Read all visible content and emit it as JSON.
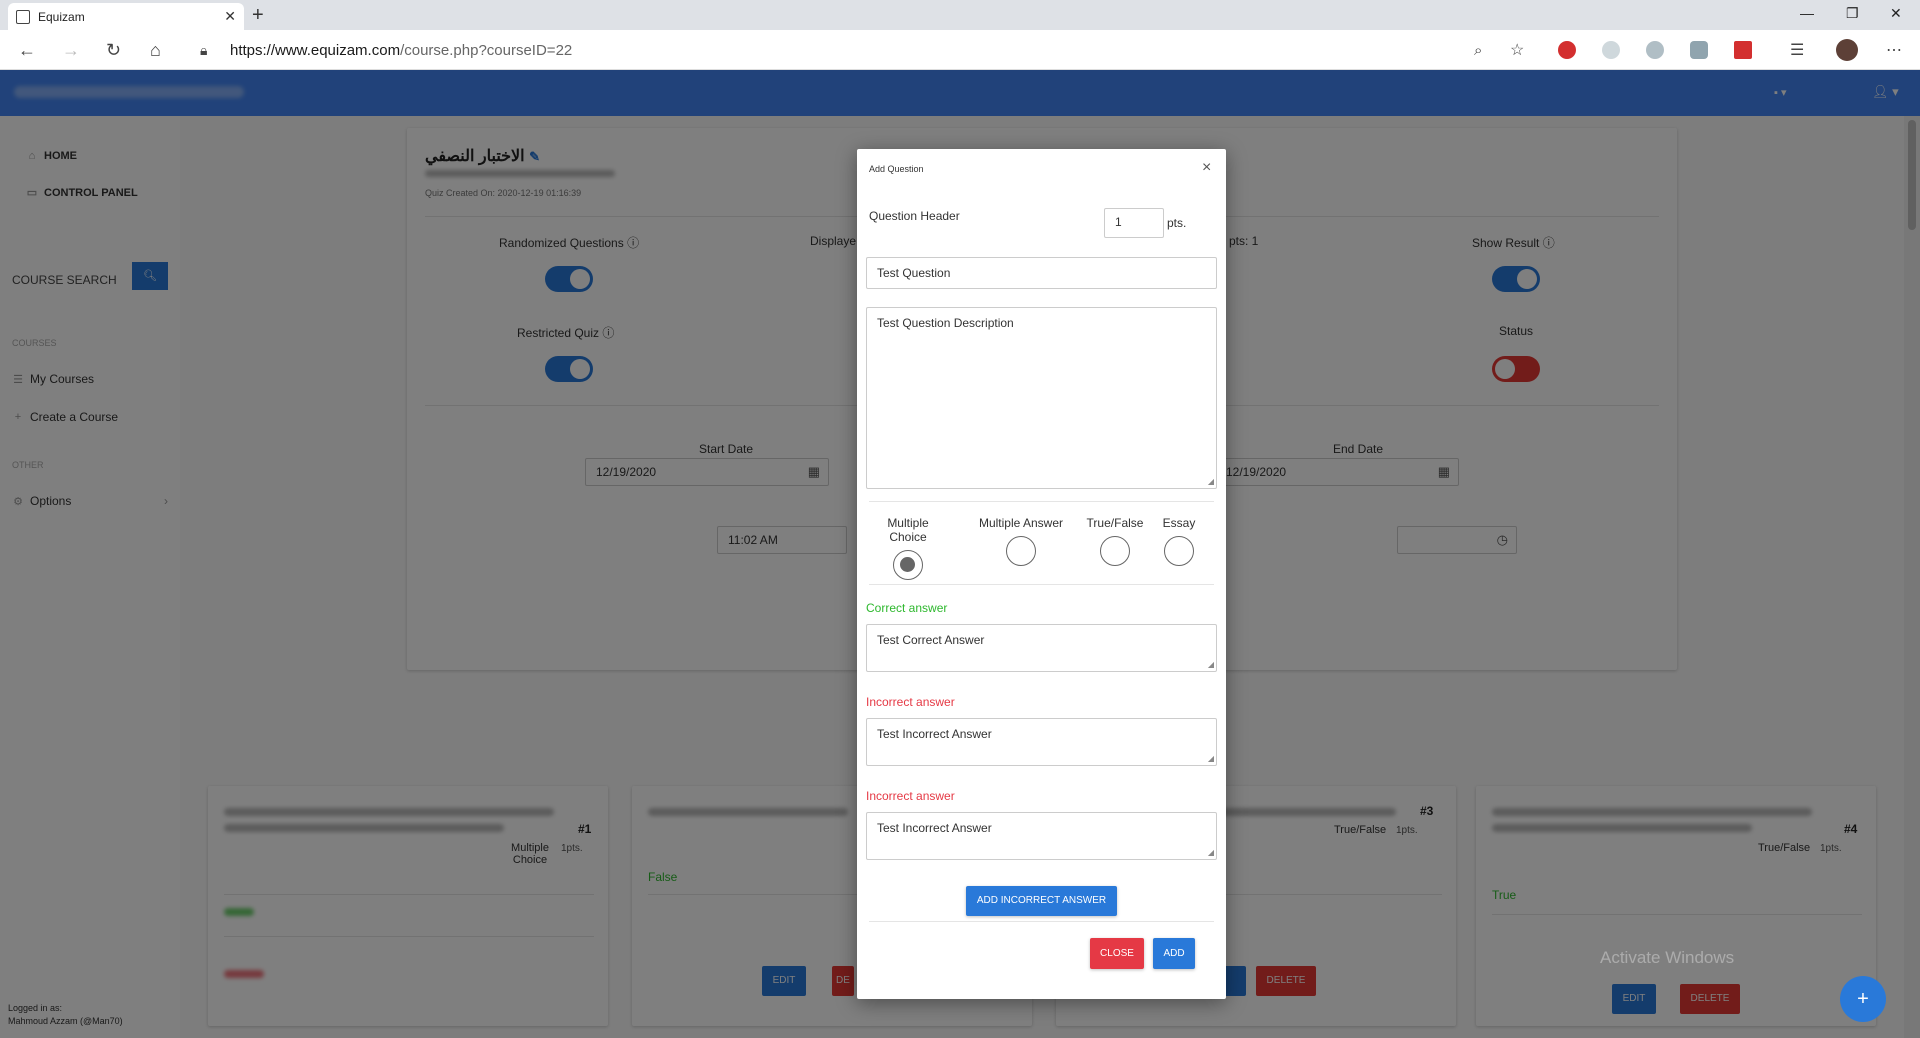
{
  "browser": {
    "tab_title": "Equizam",
    "url_host": "https://www.equizam.com",
    "url_path": "/course.php?courseID=22"
  },
  "sidebar": {
    "home": "HOME",
    "control_panel": "CONTROL PANEL",
    "course_search": "COURSE SEARCH",
    "section_courses": "COURSES",
    "my_courses": "My Courses",
    "create_course": "Create a Course",
    "section_other": "OTHER",
    "options": "Options",
    "logged_in": "Logged in as:",
    "user_name": "Mahmoud Azzam (@Man70)"
  },
  "quiz": {
    "title": "الاختبار النصفي",
    "created": "Quiz Created On: 2020-12-19 01:16:39",
    "randomized": "Randomized Questions",
    "displayed": "Displaye",
    "attempts": "pts: 1",
    "show_result": "Show Result",
    "restricted": "Restricted Quiz",
    "status": "Status",
    "start_date_label": "Start Date",
    "start_date": "12/19/2020",
    "end_date_label": "End Date",
    "end_date": "12/19/2020",
    "start_time": "11:02 AM"
  },
  "question_cards": [
    {
      "num": "#1",
      "type": "Multiple Choice",
      "pts": "1pts.",
      "answer": ""
    },
    {
      "num": "",
      "type": "",
      "pts": "",
      "answer": "False"
    },
    {
      "num": "#3",
      "type": "True/False",
      "pts": "1pts.",
      "answer": ""
    },
    {
      "num": "#4",
      "type": "True/False",
      "pts": "1pts.",
      "answer": "True"
    }
  ],
  "card_buttons": {
    "edit": "EDIT",
    "delete": "DELETE",
    "del_short": "DE"
  },
  "modal": {
    "title": "Add Question",
    "close_x": "×",
    "question_header": "Question Header",
    "points_value": "1",
    "points_unit": "pts.",
    "question": "Test Question",
    "description": "Test Question Description",
    "types": [
      {
        "label": "Multiple Choice",
        "checked": true
      },
      {
        "label": "Multiple Answer",
        "checked": false
      },
      {
        "label": "True/False",
        "checked": false
      },
      {
        "label": "Essay",
        "checked": false
      }
    ],
    "correct_label": "Correct answer",
    "correct_answer": "Test Correct Answer",
    "incorrect_label": "Incorrect answer",
    "incorrect_answer_1": "Test Incorrect Answer",
    "incorrect_answer_2": "Test Incorrect Answer",
    "add_incorrect": "ADD INCORRECT ANSWER",
    "close": "CLOSE",
    "add": "ADD"
  },
  "watermark": "Activate Windows",
  "colors": {
    "primary": "#2979d9",
    "navbar": "#4285f4",
    "danger": "#e53945",
    "success": "#2eb82e"
  }
}
